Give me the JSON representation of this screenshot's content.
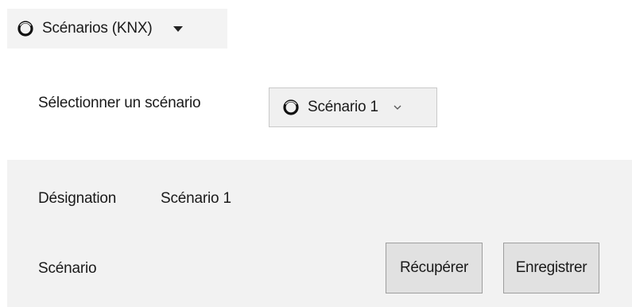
{
  "header_dropdown": {
    "icon": "ring-icon",
    "label": "Scénarios (KNX)"
  },
  "scenario_selector": {
    "label": "Sélectionner un scénario",
    "selected_value": "Scénario 1",
    "icon": "ring-icon"
  },
  "panel": {
    "designation_label": "Désignation",
    "designation_value": "Scénario 1",
    "scenario_label": "Scénario",
    "recover_button": "Récupérer",
    "save_button": "Enregistrer"
  },
  "colors": {
    "panel_background": "#f2f2f2",
    "button_background": "#e1e1e1",
    "button_border": "#9e9e9e"
  }
}
